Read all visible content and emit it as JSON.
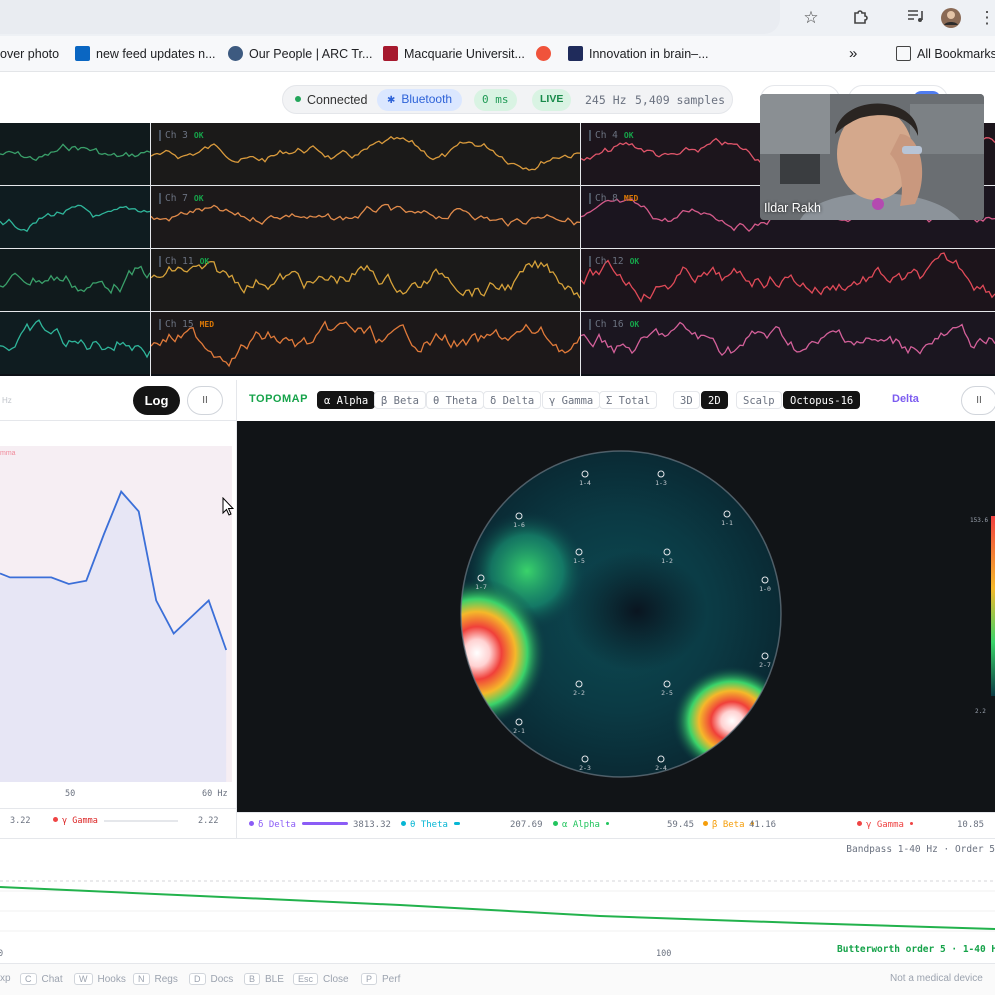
{
  "browser": {
    "bookmarks": [
      {
        "label": "over photo"
      },
      {
        "label": "new feed updates n..."
      },
      {
        "label": "Our People | ARC Tr..."
      },
      {
        "label": "Macquarie Universit..."
      },
      {
        "label": ""
      },
      {
        "label": "Innovation in brain–..."
      }
    ],
    "overflow": "»",
    "all_bookmarks": "All Bookmarks"
  },
  "status": {
    "connected": "Connected",
    "transport": "Bluetooth",
    "latency": "0 ms",
    "live": "LIVE",
    "rate": "245 Hz",
    "samples": "5,409 samples"
  },
  "video": {
    "name": "Ildar Rakh"
  },
  "channels": [
    {
      "label": "",
      "status": ""
    },
    {
      "label": "Ch 3",
      "status": "OK",
      "color": "#d99a3c"
    },
    {
      "label": "Ch 4",
      "status": "OK",
      "color": "#e0556a"
    },
    {
      "label": "",
      "status": ""
    },
    {
      "label": "Ch 7",
      "status": "OK",
      "color": "#e08a4a"
    },
    {
      "label": "Ch 8",
      "status": "MED",
      "color": "#d45a8a"
    },
    {
      "label": "",
      "status": ""
    },
    {
      "label": "Ch 11",
      "status": "OK",
      "color": "#d6a23a"
    },
    {
      "label": "Ch 12",
      "status": "OK",
      "color": "#e04a58"
    },
    {
      "label": "",
      "status": ""
    },
    {
      "label": "Ch 15",
      "status": "MED",
      "color": "#e07a3a"
    },
    {
      "label": "Ch 16",
      "status": "OK",
      "color": "#d4609a"
    }
  ],
  "spectrum": {
    "unit_partial": "Hz",
    "log_label": "Log",
    "pause_label": "II",
    "legend_partial": "mma",
    "x_ticks": [
      "50",
      "60 Hz"
    ],
    "footer": {
      "left_value": "3.22",
      "band": "γ Gamma",
      "right_value": "2.22"
    },
    "chart_data": {
      "type": "line",
      "x": [
        30,
        33,
        36,
        39,
        42,
        45,
        48,
        51,
        54,
        57,
        60
      ],
      "y": [
        0.62,
        0.6,
        0.61,
        0.75,
        0.88,
        0.82,
        0.55,
        0.45,
        0.5,
        0.55,
        0.4
      ]
    }
  },
  "topomap": {
    "title": "TOPOMAP",
    "bands": [
      "α Alpha",
      "β Beta",
      "θ Theta",
      "δ Delta",
      "γ Gamma",
      "Σ Total"
    ],
    "active_band": "α Alpha",
    "views": [
      "3D",
      "2D"
    ],
    "active_view": "2D",
    "layouts": [
      "Scalp",
      "Octopus-16"
    ],
    "active_layout": "Octopus-16",
    "selected": "Delta",
    "pause_label": "II",
    "electrodes": [
      {
        "label": "1-4"
      },
      {
        "label": "1-3"
      },
      {
        "label": "1-6"
      },
      {
        "label": "1-1"
      },
      {
        "label": "1-5"
      },
      {
        "label": "1-2"
      },
      {
        "label": "1-7"
      },
      {
        "label": "1-0"
      },
      {
        "label": "2-7"
      },
      {
        "label": "2-2"
      },
      {
        "label": "2-5"
      },
      {
        "label": "2-1"
      },
      {
        "label": "2-3"
      },
      {
        "label": "2-4"
      }
    ],
    "scale_top": "153.6",
    "scale_mid": "2.2",
    "band_powers": [
      {
        "name": "δ Delta",
        "value": "3813.32",
        "color": "#8b5cf6"
      },
      {
        "name": "θ Theta",
        "value": "207.69",
        "color": "#06b6d4"
      },
      {
        "name": "α Alpha",
        "value": "59.45",
        "color": "#22c55e"
      },
      {
        "name": "β Beta",
        "value": "41.16",
        "color": "#f59e0b"
      },
      {
        "name": "γ Gamma",
        "value": "10.85",
        "color": "#ef4444"
      }
    ]
  },
  "filter": {
    "header": "Bandpass 1-40 Hz · Order 5",
    "x_ticks": [
      "0",
      "100"
    ],
    "caption": "Butterworth order 5 · 1-40 Hz"
  },
  "shortcuts": [
    {
      "key": "",
      "label": "xp"
    },
    {
      "key": "C",
      "label": "Chat"
    },
    {
      "key": "W",
      "label": "Hooks"
    },
    {
      "key": "N",
      "label": "Regs"
    },
    {
      "key": "D",
      "label": "Docs"
    },
    {
      "key": "B",
      "label": "BLE"
    },
    {
      "key": "Esc",
      "label": "Close"
    },
    {
      "key": "P",
      "label": "Perf"
    }
  ],
  "disclaimer": "Not a medical device"
}
